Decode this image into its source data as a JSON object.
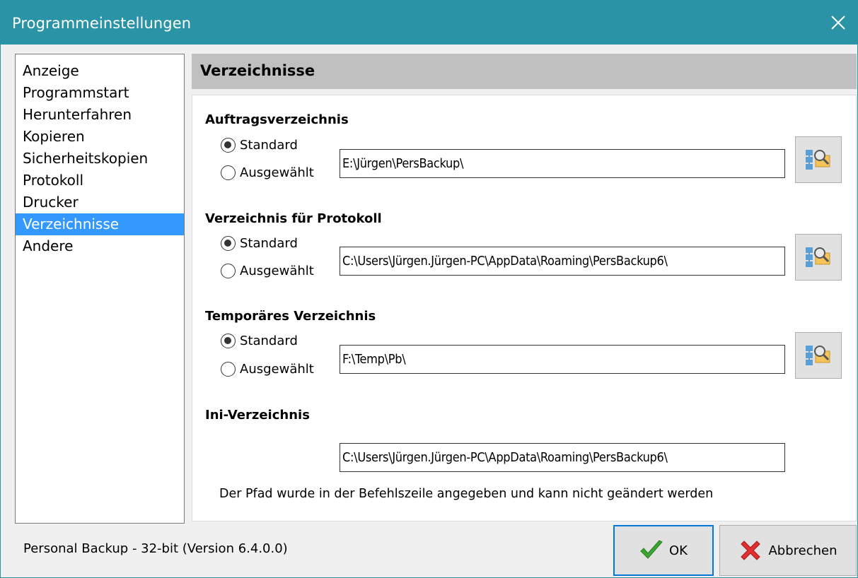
{
  "window": {
    "title": "Programmeinstellungen",
    "accent_color": "#2b93a6"
  },
  "nav": {
    "items": [
      {
        "label": "Anzeige"
      },
      {
        "label": "Programmstart"
      },
      {
        "label": "Herunterfahren"
      },
      {
        "label": "Kopieren"
      },
      {
        "label": "Sicherheitskopien"
      },
      {
        "label": "Protokoll"
      },
      {
        "label": "Drucker"
      },
      {
        "label": "Verzeichnisse",
        "selected": true
      },
      {
        "label": "Andere"
      }
    ],
    "selected_color": "#3399ff"
  },
  "page": {
    "title": "Verzeichnisse"
  },
  "sections": {
    "auftrag": {
      "title": "Auftragsverzeichnis",
      "radio_standard": "Standard",
      "radio_selected": "Ausgewählt",
      "path": "E:\\Jürgen\\PersBackup\\"
    },
    "protokoll": {
      "title": "Verzeichnis für Protokoll",
      "radio_standard": "Standard",
      "radio_selected": "Ausgewählt",
      "path": "C:\\Users\\Jürgen.Jürgen-PC\\AppData\\Roaming\\PersBackup6\\"
    },
    "temp": {
      "title": "Temporäres Verzeichnis",
      "radio_standard": "Standard",
      "radio_selected": "Ausgewählt",
      "path": "F:\\Temp\\Pb\\"
    },
    "ini": {
      "title": "Ini-Verzeichnis",
      "path": "C:\\Users\\Jürgen.Jürgen-PC\\AppData\\Roaming\\PersBackup6\\",
      "note": "Der Pfad wurde in der Befehlszeile angegeben und kann nicht geändert werden"
    }
  },
  "icons": {
    "close": "close-icon",
    "browse": "folder-browse-icon",
    "ok": "checkmark-icon",
    "cancel": "cross-icon"
  },
  "footer": {
    "status": "Personal Backup - 32-bit (Version 6.4.0.0)",
    "ok_label": "OK",
    "cancel_label": "Abbrechen"
  }
}
